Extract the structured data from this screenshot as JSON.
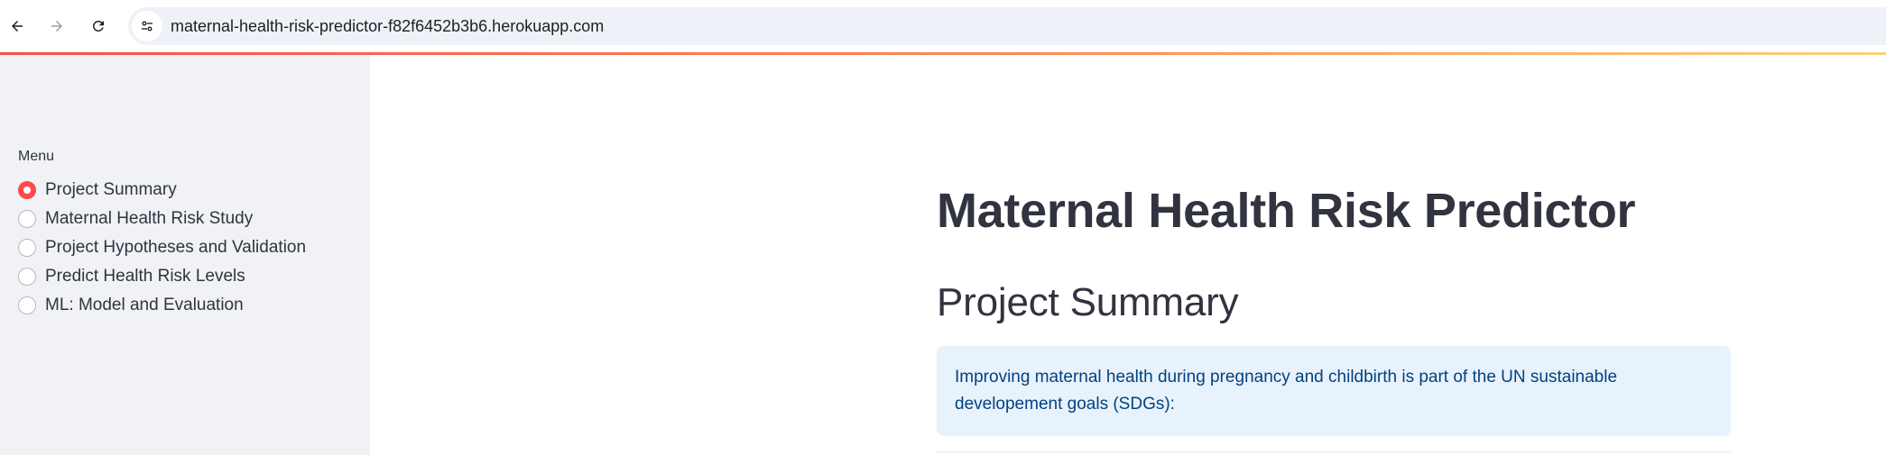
{
  "browser": {
    "url": "maternal-health-risk-predictor-f82f6452b3b6.herokuapp.com"
  },
  "theme": {
    "primary": "#ff4b4b",
    "sidebar_bg": "#f0f2f6",
    "info_bg": "#e8f2fc",
    "info_text": "#004280",
    "text": "#31333f"
  },
  "sidebar": {
    "menu_label": "Menu",
    "items": [
      {
        "label": "Project Summary",
        "selected": true
      },
      {
        "label": "Maternal Health Risk Study",
        "selected": false
      },
      {
        "label": "Project Hypotheses and Validation",
        "selected": false
      },
      {
        "label": "Predict Health Risk Levels",
        "selected": false
      },
      {
        "label": "ML: Model and Evaluation",
        "selected": false
      }
    ]
  },
  "main": {
    "title": "Maternal Health Risk Predictor",
    "section_title": "Project Summary",
    "info_text": "Improving maternal health during pregnancy and childbirth is part of the UN sustainable developement goals (SDGs):"
  }
}
